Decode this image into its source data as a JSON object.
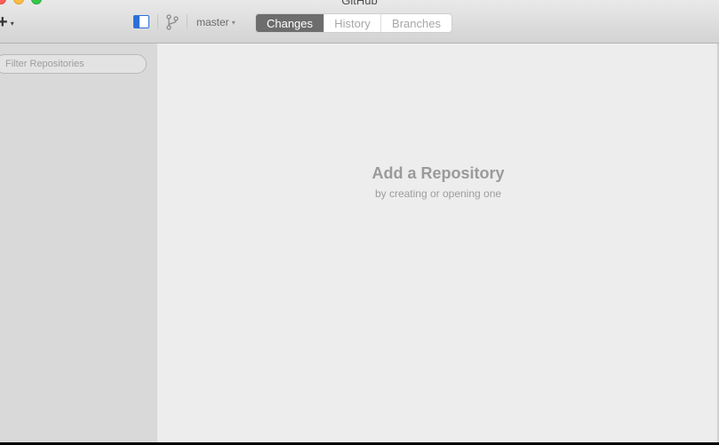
{
  "window": {
    "title": "GitHub"
  },
  "toolbar": {
    "add_icon": "plus-icon",
    "add_caret": "▾",
    "sidebar_toggle_icon": "sidebar-toggle-icon",
    "branch_icon": "git-branch-icon",
    "branch_name": "master",
    "branch_caret": "▾",
    "tabs": [
      {
        "label": "Changes",
        "active": true
      },
      {
        "label": "History",
        "active": false
      },
      {
        "label": "Branches",
        "active": false
      }
    ],
    "accent_color": "#2c6fd8"
  },
  "sidebar": {
    "filter_placeholder": "Filter Repositories"
  },
  "main": {
    "empty_title": "Add a Repository",
    "empty_subtitle": "by creating or opening one"
  }
}
